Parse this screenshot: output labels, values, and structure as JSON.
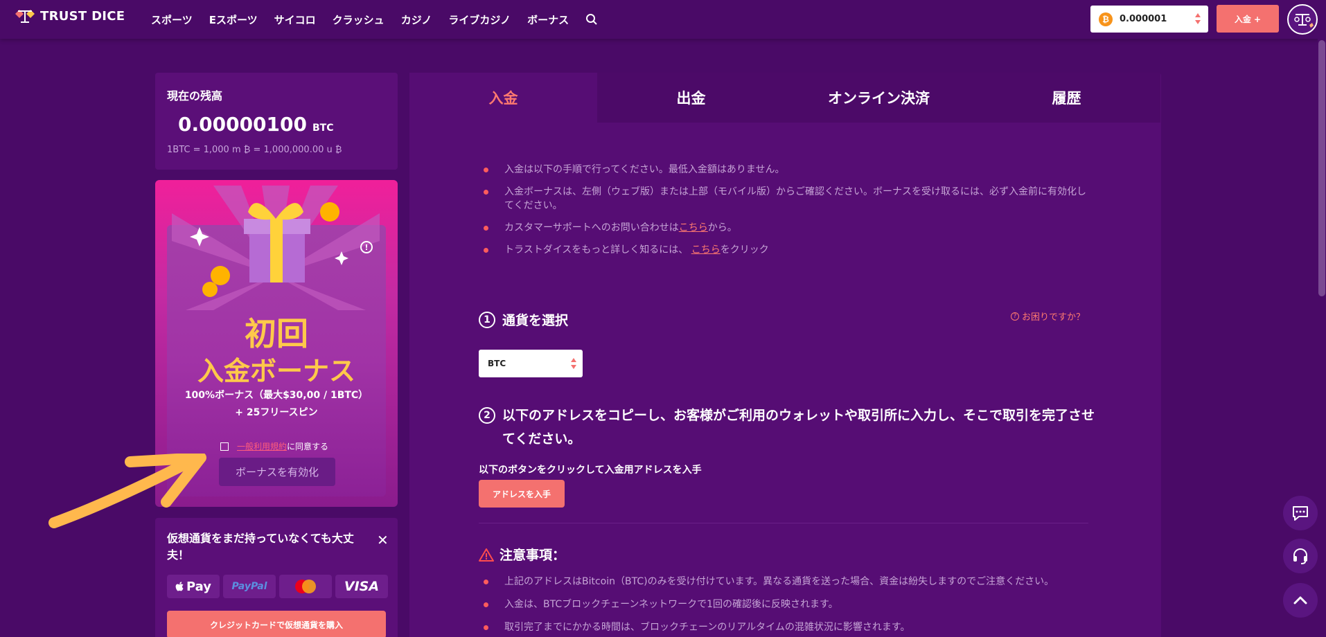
{
  "header": {
    "logo_text": "TRUST DICE",
    "nav": [
      "スポーツ",
      "Eスポーツ",
      "サイコロ",
      "クラッシュ",
      "カジノ",
      "ライブカジノ",
      "ボーナス"
    ],
    "balance_coin": "₿",
    "balance_value": "0.000001",
    "deposit_button": "入金 +"
  },
  "balance_card": {
    "title": "現在の残高",
    "amount": "0.00000100",
    "unit": "BTC",
    "rate": "1BTC = 1,000 m ₿ = 1,000,000.00 u ₿"
  },
  "bonus_card": {
    "info": "!",
    "title_line1": "初回",
    "title_line2": "入金ボーナス",
    "desc_line1": "100%ボーナス（最大$30,00 / 1BTC）",
    "desc_line2": "+ 25フリースピン",
    "terms_link": "一般利用規約",
    "terms_suffix": "に同意する",
    "activate_button": "ボーナスを有効化"
  },
  "crypto_card": {
    "title": "仮想通貨をまだ持っていなくても大丈夫！",
    "close": "✕",
    "payments": [
      "Pay",
      "PayPal",
      "",
      "VISA"
    ],
    "buy_button": "クレジットカードで仮想通貨を購入"
  },
  "tabs": [
    "入金",
    "出金",
    "オンライン決済",
    "履歴"
  ],
  "rules": [
    {
      "text": "入金は以下の手順で行ってください。最低入金額はありません。"
    },
    {
      "text": "入金ボーナスは、左側（ウェブ版）または上部（モバイル版）からご確認ください。ボーナスを受け取るには、必ず入金前に有効化してください。"
    },
    {
      "prefix": "カスタマーサポートへのお問い合わせは",
      "link": "こちら",
      "suffix": "から。"
    },
    {
      "prefix": "トラストダイスをもっと詳しく知るには、 ",
      "link": "こちら",
      "suffix": "をクリック"
    }
  ],
  "step1": {
    "number": "1",
    "title": "通貨を選択",
    "help": "お困りですか？",
    "currency": "BTC"
  },
  "step2": {
    "number": "2",
    "title": "以下のアドレスをコピーし、お客様がご利用のウォレットや取引所に入力し、そこで取引を完了させてください。",
    "label": "以下のボタンをクリックして入金用アドレスを入手",
    "button": "アドレスを入手"
  },
  "notice": {
    "title": "注意事項：",
    "items": [
      "上記のアドレスはBitcoin（BTC)のみを受け付けています。異なる通貨を送った場合、資金は紛失しますのでご注意ください。",
      "入金は、BTCブロックチェーンネットワークで1回の確認後に反映されます。",
      "取引完了までにかかる時間は、ブロックチェーンのリアルタイムの混雑状況に影響されます。"
    ]
  }
}
